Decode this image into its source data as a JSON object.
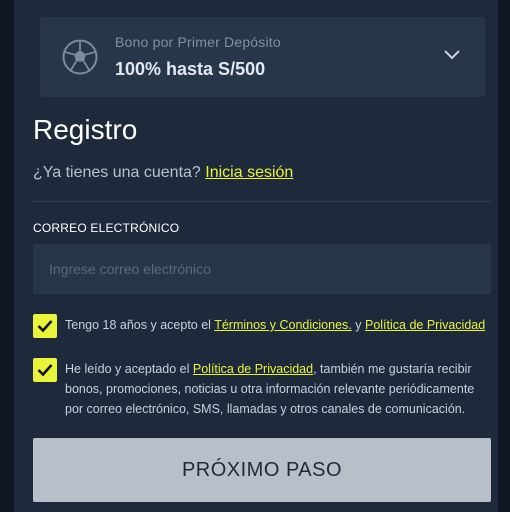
{
  "bonus": {
    "subtitle": "Bono por Primer Depósito",
    "title": "100% hasta S/500",
    "icon": "soccer-ball-icon"
  },
  "form": {
    "title": "Registro",
    "account_question": "¿Ya tienes una cuenta?",
    "login_link": "Inicia sesión",
    "email_label": "CORREO ELECTRÓNICO",
    "email_placeholder": "Ingrese correo electrónico",
    "email_value": ""
  },
  "consent1": {
    "checked": true,
    "text_before": "Tengo 18 años y acepto el ",
    "terms_link": "Términos y Condiciones.",
    "conjunction": " y ",
    "privacy_link": "Política de Privacidad"
  },
  "consent2": {
    "checked": true,
    "text_before": "He leído y aceptado el ",
    "privacy_link": "Política de Privacidad",
    "text_after": ", también me gustaría recibir bonos, promociones, noticias u otra información relevante periódicamente por correo electrónico, SMS, llamadas y otros canales de comunicación."
  },
  "next_button": "PRÓXIMO PASO",
  "colors": {
    "accent": "#e8f43a",
    "background": "#1e2a3b",
    "card": "#28364a"
  }
}
